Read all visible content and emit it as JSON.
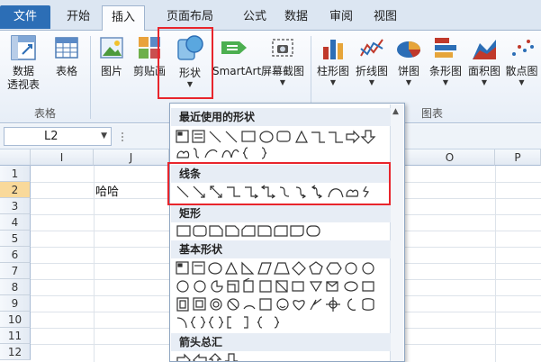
{
  "tabs": {
    "file": "文件",
    "home": "开始",
    "insert": "插入",
    "page_layout": "页面布局",
    "formulas": "公式",
    "data": "数据",
    "review": "审阅",
    "view": "视图"
  },
  "ribbon": {
    "pivot_table_line1": "数据",
    "pivot_table_line2": "透视表",
    "table": "表格",
    "picture": "图片",
    "clip_art": "剪贴画",
    "shapes": "形状",
    "smartart": "SmartArt",
    "screenshot": "屏幕截图",
    "column_chart": "柱形图",
    "line_chart": "折线图",
    "pie_chart": "饼图",
    "bar_chart": "条形图",
    "area_chart": "面积图",
    "scatter_chart": "散点图",
    "group_tables": "表格",
    "group_charts": "图表"
  },
  "name_box": "L2",
  "columns": [
    "I",
    "J",
    "O",
    "P"
  ],
  "rows": [
    "1",
    "2",
    "3",
    "4",
    "5",
    "6",
    "7",
    "8",
    "9",
    "10",
    "11",
    "12"
  ],
  "cell_j2": "哈哈",
  "shapes_menu": {
    "recent": "最近使用的形状",
    "lines": "线条",
    "rectangles": "矩形",
    "basic_shapes": "基本形状",
    "block_arrows": "箭头总汇"
  },
  "colors": {
    "accent_red": "#e8252c",
    "file_tab": "#2c6eb6",
    "selected_row": "#f9d99a"
  }
}
